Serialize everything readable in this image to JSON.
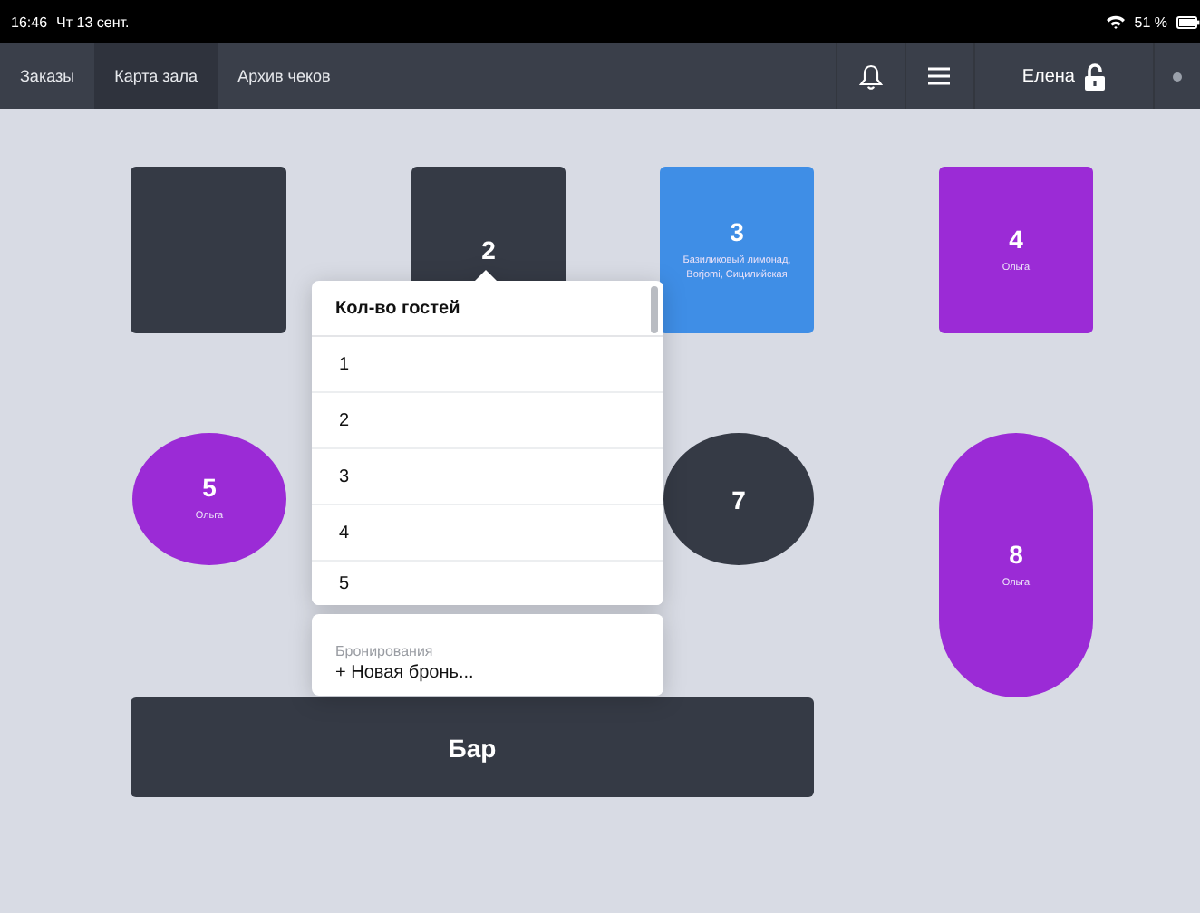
{
  "status_bar": {
    "time": "16:46",
    "date": "Чт 13 сент.",
    "battery": "51 %"
  },
  "nav": {
    "tabs": [
      {
        "label": "Заказы",
        "selected": false
      },
      {
        "label": "Карта зала",
        "selected": true
      },
      {
        "label": "Архив чеков",
        "selected": false
      }
    ],
    "user": "Елена"
  },
  "tables": [
    {
      "kind": "square",
      "color": "#353a45"
    },
    {
      "kind": "square",
      "color": "#353a45",
      "number": "2"
    },
    {
      "kind": "square",
      "color": "#3f8ee6",
      "number": "3",
      "note": "Базиликовый лимонад, Borjomi, Сицилийская"
    },
    {
      "kind": "square",
      "color": "#9b2bd6",
      "number": "4",
      "note": "Ольга"
    },
    {
      "kind": "round",
      "color": "#9b2bd6",
      "number": "5",
      "note": "Ольга"
    },
    {
      "kind": "round",
      "color": "#353a45",
      "number": "7"
    },
    {
      "kind": "pill",
      "color": "#9b2bd6",
      "number": "8",
      "note": "Ольга"
    },
    {
      "kind": "bar",
      "color": "#353a45",
      "number": "Бар"
    }
  ],
  "guest_picker": {
    "title": "Кол-во гостей",
    "options": [
      "1",
      "2",
      "3",
      "4",
      "5"
    ],
    "reservations_label": "Бронирования",
    "new_booking": "+ Новая бронь..."
  }
}
